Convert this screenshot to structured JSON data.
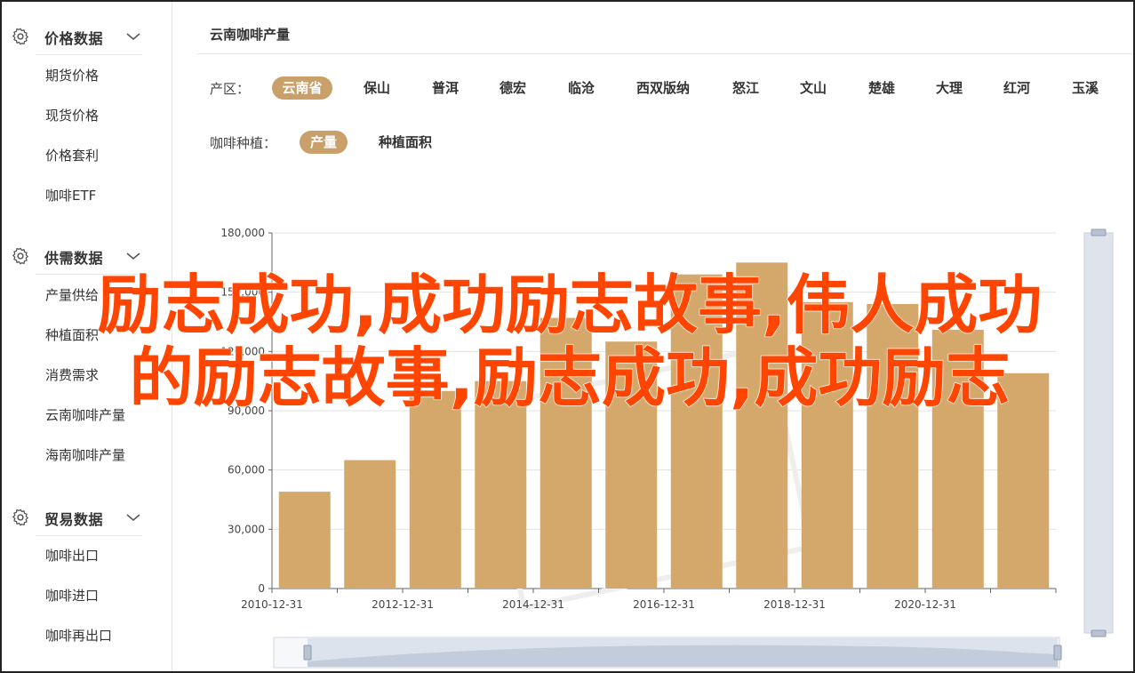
{
  "sidebar": {
    "sections": [
      {
        "title": "价格数据",
        "items": [
          "期货价格",
          "现货价格",
          "价格套利",
          "咖啡ETF"
        ]
      },
      {
        "title": "供需数据",
        "items": [
          "产量供给",
          "种植面积",
          "消费需求",
          "云南咖啡产量",
          "海南咖啡产量"
        ]
      },
      {
        "title": "贸易数据",
        "items": [
          "咖啡出口",
          "咖啡进口",
          "咖啡再出口"
        ]
      }
    ]
  },
  "main": {
    "title": "云南咖啡产量",
    "region_label": "产区：",
    "regions": [
      "云南省",
      "保山",
      "普洱",
      "德宏",
      "临沧",
      "西双版纳",
      "怒江",
      "文山",
      "楚雄",
      "大理",
      "红河",
      "玉溪"
    ],
    "planting_label": "咖啡种植：",
    "planting_options": [
      "产量",
      "种植面积"
    ]
  },
  "headline": {
    "line1": "励志成功,成功励志故事,伟人成功",
    "line2": "的励志故事,励志成功,成功励志"
  },
  "colors": {
    "accent": "#c9a06a",
    "bar": "#d4a76a",
    "headline": "#ff4500"
  },
  "chart_data": {
    "type": "bar",
    "x": [
      "2010-12-31",
      "2011-12-31",
      "2012-12-31",
      "2013-12-31",
      "2014-12-31",
      "2015-12-31",
      "2016-12-31",
      "2017-12-31",
      "2018-12-31",
      "2019-12-31",
      "2020-12-31",
      "2021-12-31"
    ],
    "values": [
      49000,
      65000,
      100000,
      105000,
      137000,
      125000,
      159000,
      165000,
      145000,
      144000,
      131000,
      109000
    ],
    "x_tick_labels": [
      "2010-12-31",
      "2012-12-31",
      "2014-12-31",
      "2016-12-31",
      "2018-12-31",
      "2020-12-31"
    ],
    "y_tick_labels": [
      "0",
      "30,000",
      "60,000",
      "90,000",
      "120,000",
      "150,000",
      "180,000"
    ],
    "ylim": [
      0,
      180000
    ],
    "grid": true,
    "title": "",
    "xlabel": "",
    "ylabel": ""
  }
}
